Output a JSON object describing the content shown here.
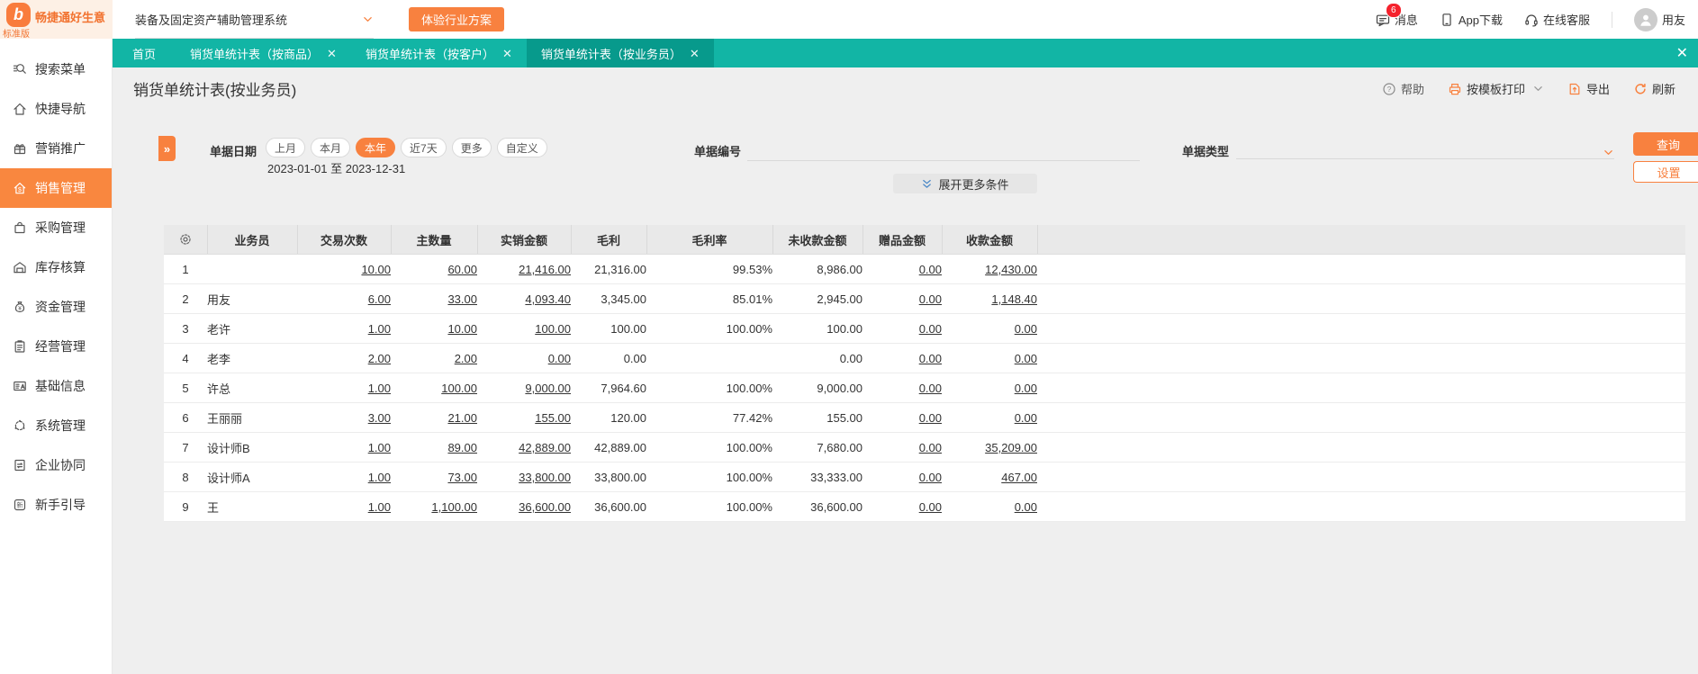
{
  "colors": {
    "accent_orange": "#f8813f",
    "teal_bar": "#12b5a5",
    "teal_active_tab": "#079a8c",
    "badge_red": "#f5222d",
    "sidebar_active": "#f9873f"
  },
  "topbar": {
    "brand": "畅捷通好生意",
    "edition": "标准版",
    "system_selector": "装备及固定资产辅助管理系统",
    "trial_button": "体验行业方案",
    "messages_label": "消息",
    "messages_badge": "6",
    "app_download_label": "App下载",
    "online_service_label": "在线客服",
    "user_name": "用友"
  },
  "sidebar": {
    "items": [
      {
        "id": "search-menu",
        "icon": "search-icon",
        "label": "搜索菜单",
        "active": false
      },
      {
        "id": "quick-nav",
        "icon": "home-icon",
        "label": "快捷导航",
        "active": false
      },
      {
        "id": "marketing",
        "icon": "gift-icon",
        "label": "营销推广",
        "active": false
      },
      {
        "id": "sales-mgmt",
        "icon": "sales-house-icon",
        "label": "销售管理",
        "active": true
      },
      {
        "id": "purchase-mgmt",
        "icon": "shopping-bag-icon",
        "label": "采购管理",
        "active": false
      },
      {
        "id": "inventory-accounting",
        "icon": "warehouse-icon",
        "label": "库存核算",
        "active": false
      },
      {
        "id": "funds-mgmt",
        "icon": "money-bag-icon",
        "label": "资金管理",
        "active": false
      },
      {
        "id": "operations-mgmt",
        "icon": "clipboard-icon",
        "label": "经营管理",
        "active": false
      },
      {
        "id": "base-info",
        "icon": "id-card-icon",
        "label": "基础信息",
        "active": false
      },
      {
        "id": "system-mgmt",
        "icon": "system-gear-icon",
        "label": "系统管理",
        "active": false
      },
      {
        "id": "enterprise-collab",
        "icon": "collab-doc-icon",
        "label": "企业协同",
        "active": false
      },
      {
        "id": "newbie-guide",
        "icon": "guide-badge-icon",
        "label": "新手引导",
        "active": false
      }
    ]
  },
  "tabs": [
    {
      "id": "home",
      "label": "首页",
      "closable": false,
      "active": false
    },
    {
      "id": "by-product",
      "label": "销货单统计表（按商品）",
      "closable": true,
      "active": false
    },
    {
      "id": "by-customer",
      "label": "销货单统计表（按客户）",
      "closable": true,
      "active": false
    },
    {
      "id": "by-salesperson",
      "label": "销货单统计表（按业务员）",
      "closable": true,
      "active": true
    }
  ],
  "page": {
    "title": "销货单统计表(按业务员)",
    "toolbar": {
      "help": "帮助",
      "print": "按模板打印",
      "export": "导出",
      "refresh": "刷新"
    }
  },
  "filters": {
    "date_label": "单据日期",
    "date_pills": [
      "上月",
      "本月",
      "本年",
      "近7天",
      "更多",
      "自定义"
    ],
    "date_selected": "本年",
    "date_range": "2023-01-01 至 2023-12-31",
    "doc_no_label": "单据编号",
    "doc_no_value": "",
    "doc_type_label": "单据类型",
    "doc_type_value": "",
    "query_button": "查询",
    "settings_button": "设置",
    "expand_more_label": "展开更多条件"
  },
  "table": {
    "columns": [
      "业务员",
      "交易次数",
      "主数量",
      "实销金额",
      "毛利",
      "毛利率",
      "未收款金额",
      "赠品金额",
      "收款金额"
    ],
    "link_columns": [
      0,
      1,
      2,
      6,
      7
    ],
    "rows": [
      {
        "index": "1",
        "name": "",
        "values": [
          "10.00",
          "60.00",
          "21,416.00",
          "21,316.00",
          "99.53%",
          "8,986.00",
          "0.00",
          "12,430.00"
        ]
      },
      {
        "index": "2",
        "name": "用友",
        "values": [
          "6.00",
          "33.00",
          "4,093.40",
          "3,345.00",
          "85.01%",
          "2,945.00",
          "0.00",
          "1,148.40"
        ]
      },
      {
        "index": "3",
        "name": "老许",
        "values": [
          "1.00",
          "10.00",
          "100.00",
          "100.00",
          "100.00%",
          "100.00",
          "0.00",
          "0.00"
        ]
      },
      {
        "index": "4",
        "name": "老李",
        "values": [
          "2.00",
          "2.00",
          "0.00",
          "0.00",
          "",
          "0.00",
          "0.00",
          "0.00"
        ]
      },
      {
        "index": "5",
        "name": "许总",
        "values": [
          "1.00",
          "100.00",
          "9,000.00",
          "7,964.60",
          "100.00%",
          "9,000.00",
          "0.00",
          "0.00"
        ]
      },
      {
        "index": "6",
        "name": "王丽丽",
        "values": [
          "3.00",
          "21.00",
          "155.00",
          "120.00",
          "77.42%",
          "155.00",
          "0.00",
          "0.00"
        ]
      },
      {
        "index": "7",
        "name": "设计师B",
        "values": [
          "1.00",
          "89.00",
          "42,889.00",
          "42,889.00",
          "100.00%",
          "7,680.00",
          "0.00",
          "35,209.00"
        ]
      },
      {
        "index": "8",
        "name": "设计师A",
        "values": [
          "1.00",
          "73.00",
          "33,800.00",
          "33,800.00",
          "100.00%",
          "33,333.00",
          "0.00",
          "467.00"
        ]
      },
      {
        "index": "9",
        "name": "王",
        "values": [
          "1.00",
          "1,100.00",
          "36,600.00",
          "36,600.00",
          "100.00%",
          "36,600.00",
          "0.00",
          "0.00"
        ]
      }
    ]
  }
}
